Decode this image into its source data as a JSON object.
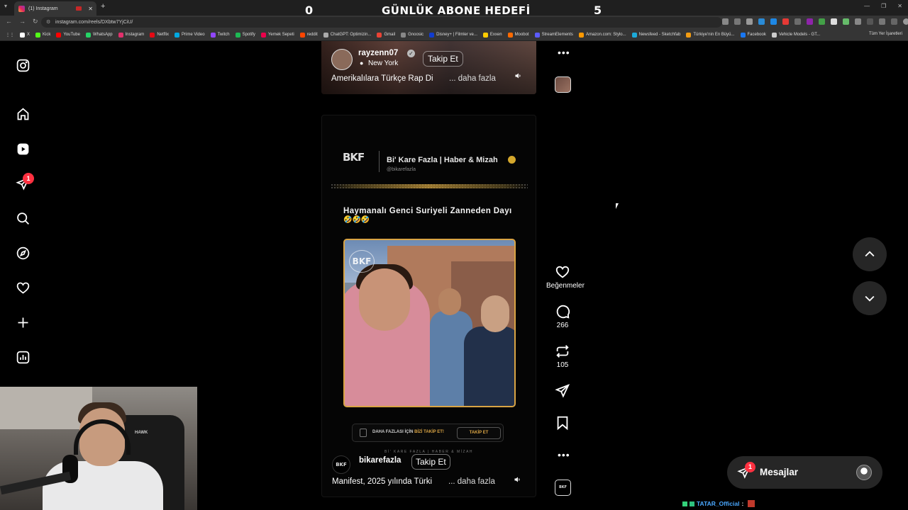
{
  "browser": {
    "tab_title": "(1) Instagram",
    "url": "instagram.com/reels/DXbtw7YjCiU/",
    "all_bookmarks": "Tüm Yer İşaretleri",
    "bookmarks": [
      {
        "label": "X",
        "color": "#ffffff"
      },
      {
        "label": "Kick",
        "color": "#53fc18"
      },
      {
        "label": "YouTube",
        "color": "#ff0000"
      },
      {
        "label": "WhatsApp",
        "color": "#25d366"
      },
      {
        "label": "Instagram",
        "color": "#e1306c"
      },
      {
        "label": "Netflix",
        "color": "#e50914"
      },
      {
        "label": "Prime Video",
        "color": "#00a8e1"
      },
      {
        "label": "Twitch",
        "color": "#9146ff"
      },
      {
        "label": "Spotify",
        "color": "#1db954"
      },
      {
        "label": "Yemek Sepeti",
        "color": "#ea004b"
      },
      {
        "label": "reddit",
        "color": "#ff4500"
      },
      {
        "label": "ChatGPT: Optimizin...",
        "color": "#aaaaaa"
      },
      {
        "label": "Gmail",
        "color": "#ea4335"
      },
      {
        "label": "Gnoosic",
        "color": "#888888"
      },
      {
        "label": "Disney+ | Filmler ve...",
        "color": "#113ccf"
      },
      {
        "label": "Exxen",
        "color": "#ffcc00"
      },
      {
        "label": "Moobot",
        "color": "#ff6a00"
      },
      {
        "label": "StreamElements",
        "color": "#5b5bff"
      },
      {
        "label": "Amazon.com: Stylo...",
        "color": "#ff9900"
      },
      {
        "label": "Newsfeed - Sketchfab",
        "color": "#1caad9"
      },
      {
        "label": "Türkiye'nin En Büyü...",
        "color": "#f39c12"
      },
      {
        "label": "Facebook",
        "color": "#1877f2"
      },
      {
        "label": "Vehicle Models - GT...",
        "color": "#cccccc"
      }
    ]
  },
  "stream_overlay": {
    "left_count": "0",
    "title": "GÜNLÜK ABONE HEDEFİ",
    "right_count": "5"
  },
  "sidebar": {
    "items": [
      {
        "icon": "instagram-logo-icon"
      },
      {
        "icon": "home-icon"
      },
      {
        "icon": "reels-icon"
      },
      {
        "icon": "direct-icon",
        "badge": "1"
      },
      {
        "icon": "search-icon"
      },
      {
        "icon": "explore-icon"
      },
      {
        "icon": "heart-icon"
      },
      {
        "icon": "create-icon"
      },
      {
        "icon": "dashboard-icon"
      }
    ]
  },
  "reel_top": {
    "username": "rayzenn07",
    "location": "New York",
    "follow": "Takip Et",
    "caption": "Amerikalılara Türkçe Rap Di",
    "more": "... daha fazla"
  },
  "reel_main": {
    "page_name": "Bi' Kare Fazla | Haber & Mizah",
    "page_handle": "@bikarefazla",
    "logo_text": "BKF",
    "headline": "Haymanalı Genci Suriyeli Zanneden Dayı",
    "emoji": "🤣🤣🤣",
    "cta_text_a": "DAHA FAZLASI İÇİN ",
    "cta_text_b": "BİZİ TAKİP ET!",
    "cta_button": "TAKİP ET",
    "footer": "Bİ' KARE FAZLA | HABER & MİZAH",
    "username": "bikarefazla",
    "follow": "Takip Et",
    "caption": "Manifest, 2025 yılında Türki",
    "more": "... daha fazla"
  },
  "actions": {
    "like_label": "Beğenmeler",
    "comments": "266",
    "reposts": "105"
  },
  "messages": {
    "label": "Mesajlar",
    "badge": "1"
  },
  "chat": {
    "user": "TATAR_Official",
    "colon": ":"
  }
}
